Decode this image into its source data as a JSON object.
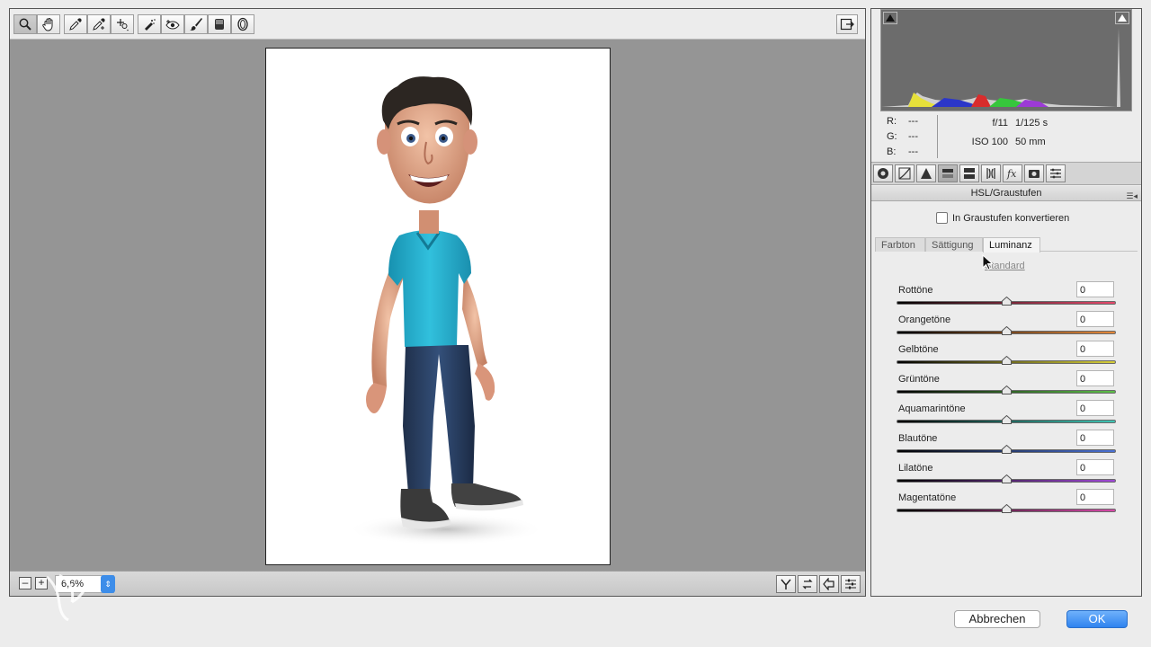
{
  "toolbar": {
    "tools": [
      {
        "name": "zoom-tool",
        "icon": "magnifier-icon"
      },
      {
        "name": "hand-tool",
        "icon": "hand-icon"
      },
      {
        "name": "white-balance-tool",
        "icon": "eyedropper-icon"
      },
      {
        "name": "color-sampler-tool",
        "icon": "eyedropper-plus-icon"
      },
      {
        "name": "targeted-adjustment-tool",
        "icon": "target-adjust-icon"
      },
      {
        "name": "spot-removal-tool",
        "icon": "spot-heal-icon"
      },
      {
        "name": "red-eye-tool",
        "icon": "eye-icon"
      },
      {
        "name": "adjustment-brush-tool",
        "icon": "brush-icon"
      },
      {
        "name": "graduated-filter-tool",
        "icon": "graduated-filter-icon"
      },
      {
        "name": "radial-filter-tool",
        "icon": "radial-filter-icon"
      }
    ],
    "fullscreen_icon": "fullscreen-icon"
  },
  "status": {
    "zoom_out_label": "–",
    "zoom_in_label": "+",
    "zoom_value": "6,6%"
  },
  "info": {
    "r_label": "R:",
    "r_value": "---",
    "g_label": "G:",
    "g_value": "---",
    "b_label": "B:",
    "b_value": "---",
    "aperture": "f/11",
    "shutter": "1/125 s",
    "iso": "ISO 100",
    "focal": "50 mm"
  },
  "panel": {
    "title": "HSL/Graustufen",
    "grayscale_label": "In Graustufen konvertieren",
    "subtabs": [
      "Farbton",
      "Sättigung",
      "Luminanz"
    ],
    "active_subtab": "Luminanz",
    "standard_label": "Standard",
    "sliders": [
      {
        "label": "Rottöne",
        "value": "0",
        "position": 0.5,
        "colors": [
          "#000000",
          "#e64a6c"
        ]
      },
      {
        "label": "Orangetöne",
        "value": "0",
        "position": 0.5,
        "colors": [
          "#000000",
          "#e6893a"
        ]
      },
      {
        "label": "Gelbtöne",
        "value": "0",
        "position": 0.5,
        "colors": [
          "#000000",
          "#d8d03a"
        ]
      },
      {
        "label": "Grüntöne",
        "value": "0",
        "position": 0.5,
        "colors": [
          "#000000",
          "#5ec14a"
        ]
      },
      {
        "label": "Aquamarintöne",
        "value": "0",
        "position": 0.5,
        "colors": [
          "#000000",
          "#3fc7b6"
        ]
      },
      {
        "label": "Blautöne",
        "value": "0",
        "position": 0.5,
        "colors": [
          "#000000",
          "#4a72d6"
        ]
      },
      {
        "label": "Lilatöne",
        "value": "0",
        "position": 0.5,
        "colors": [
          "#000000",
          "#a04ad6"
        ]
      },
      {
        "label": "Magentatöne",
        "value": "0",
        "position": 0.5,
        "colors": [
          "#000000",
          "#d64aa8"
        ]
      }
    ]
  },
  "buttons": {
    "cancel": "Abbrechen",
    "ok": "OK"
  },
  "colors": {
    "ok_button": "#2f83ef",
    "canvas_bg": "#959595",
    "histogram_bg": "#6c6c6c"
  }
}
